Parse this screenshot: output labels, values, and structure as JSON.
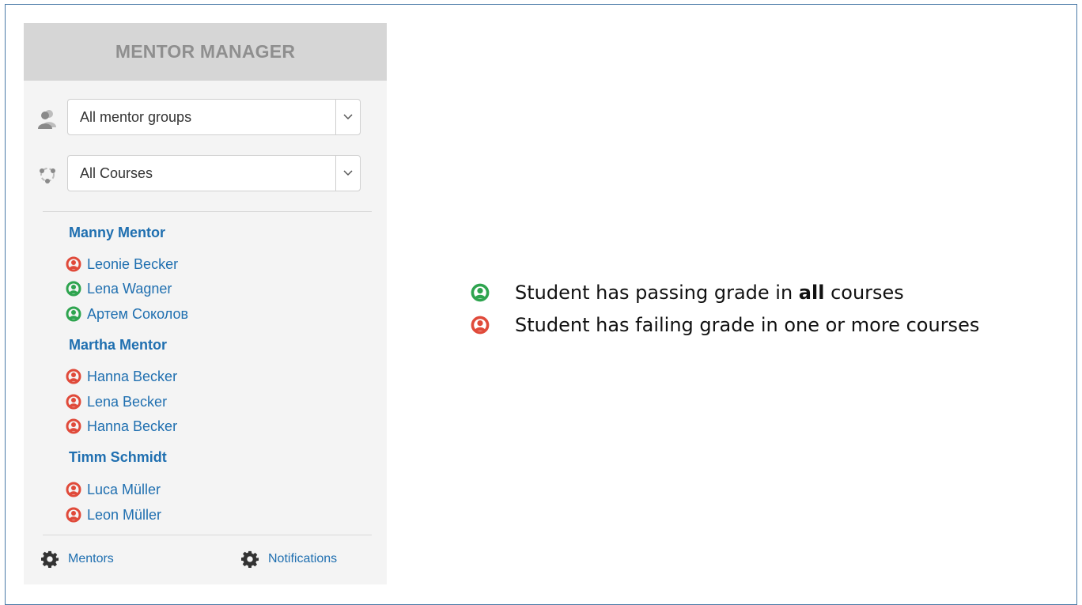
{
  "block": {
    "title": "MENTOR MANAGER",
    "group_filter": {
      "selected": "All mentor groups"
    },
    "course_filter": {
      "selected": "All Courses"
    }
  },
  "mentors": [
    {
      "name": "Manny Mentor",
      "students": [
        {
          "name": "Leonie Becker",
          "status": "failing"
        },
        {
          "name": "Lena Wagner",
          "status": "passing"
        },
        {
          "name": "Артем Соколов",
          "status": "passing"
        }
      ]
    },
    {
      "name": "Martha Mentor",
      "students": [
        {
          "name": "Hanna Becker",
          "status": "failing"
        },
        {
          "name": "Lena Becker",
          "status": "failing"
        },
        {
          "name": "Hanna Becker",
          "status": "failing"
        }
      ]
    },
    {
      "name": "Timm Schmidt",
      "students": [
        {
          "name": "Luca Müller",
          "status": "failing"
        },
        {
          "name": "Leon Müller",
          "status": "failing"
        }
      ]
    }
  ],
  "footer": {
    "mentors_link": "Mentors",
    "notifications_link": "Notifications"
  },
  "legend": {
    "passing": {
      "prefix": "Student has passing grade in ",
      "emphasis": "all",
      "suffix": " courses"
    },
    "failing": {
      "text": "Student has failing grade in one or more courses"
    }
  },
  "colors": {
    "passing": "#2ea44f",
    "failing": "#e04a3a",
    "link": "#1f6fb0",
    "header_bg": "#d6d6d6",
    "block_bg": "#f4f4f4"
  }
}
